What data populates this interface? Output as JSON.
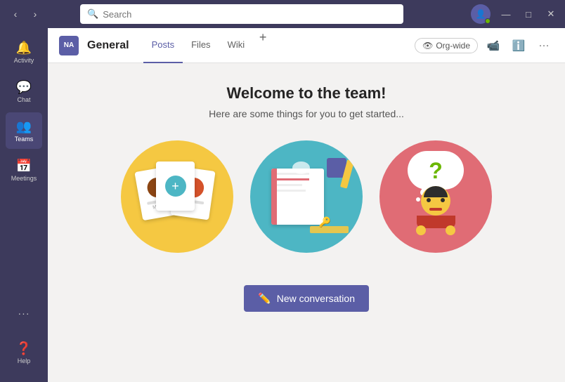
{
  "titlebar": {
    "search_placeholder": "Search"
  },
  "sidebar": {
    "items": [
      {
        "label": "Activity",
        "icon": "🔔",
        "id": "activity",
        "active": false
      },
      {
        "label": "Chat",
        "icon": "💬",
        "id": "chat",
        "active": false
      },
      {
        "label": "Teams",
        "icon": "👥",
        "id": "teams",
        "active": true
      },
      {
        "label": "Meetings",
        "icon": "📅",
        "id": "meetings",
        "active": false
      },
      {
        "label": "...",
        "icon": "···",
        "id": "more",
        "active": false
      }
    ],
    "help_label": "Help"
  },
  "channel": {
    "avatar_initials": "NA",
    "name": "General",
    "tabs": [
      {
        "label": "Posts",
        "active": true
      },
      {
        "label": "Files",
        "active": false
      },
      {
        "label": "Wiki",
        "active": false
      }
    ],
    "add_tab_label": "+",
    "org_wide_label": "Org-wide"
  },
  "main": {
    "welcome_title": "Welcome to the team!",
    "welcome_subtitle": "Here are some things for you to get started...",
    "new_conversation_label": "New conversation"
  },
  "window": {
    "minimize": "—",
    "maximize": "□",
    "close": "✕"
  }
}
